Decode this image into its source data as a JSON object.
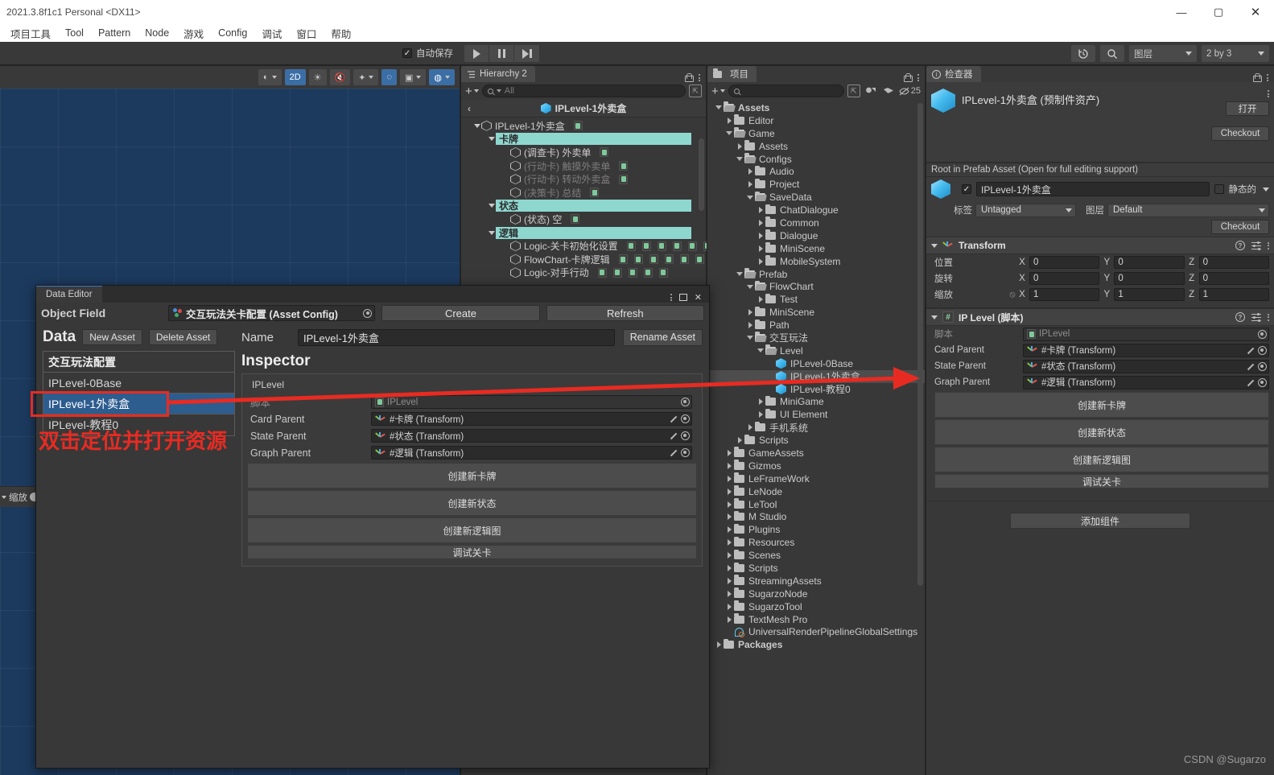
{
  "window": {
    "title": "2021.3.8f1c1 Personal <DX11>",
    "minimize": "—",
    "maximize": "▢",
    "close": "✕"
  },
  "menu": {
    "items": [
      "项目工具",
      "Tool",
      "Pattern",
      "Node",
      "游戏",
      "Config",
      "调试",
      "窗口",
      "帮助"
    ]
  },
  "toolbar": {
    "play": "play-icon",
    "pause": "pause-icon",
    "step": "step-icon",
    "history_icon": "history-icon",
    "search_icon": "search-icon",
    "layers_label": "图层",
    "layout_label": "2 by 3"
  },
  "scene": {
    "autosave_label": "自动保存",
    "autosave_checked": "✓",
    "toolbar_buttons": [
      {
        "name": "shading-mode",
        "label": "◐",
        "active": false,
        "caret": true
      },
      {
        "name": "2d-toggle",
        "label": "2D",
        "active": true,
        "caret": false
      },
      {
        "name": "lighting-toggle",
        "label": "☀",
        "active": false,
        "caret": false
      },
      {
        "name": "audio-toggle",
        "label": "🔇",
        "active": false,
        "caret": false
      },
      {
        "name": "effects-toggle",
        "label": "✦",
        "active": false,
        "caret": true
      },
      {
        "name": "hidden-objects-toggle",
        "label": "◌",
        "active": true,
        "caret": false
      },
      {
        "name": "camera-settings",
        "label": "▣",
        "active": false,
        "caret": true
      },
      {
        "name": "gizmos-toggle",
        "label": "◍",
        "active": true,
        "caret": true
      }
    ],
    "bottom_label": "缩放"
  },
  "hierarchy": {
    "tab_label": "Hierarchy 2",
    "search_placeholder": "All",
    "breadcrumb": "IPLevel-1外卖盒",
    "tree": [
      {
        "indent": 0,
        "guide": "",
        "fold": "down",
        "label": "IPLevel-1外卖盒",
        "style": "normal",
        "badges": 1
      },
      {
        "indent": 1,
        "guide": "├",
        "fold": "down",
        "label": "卡牌",
        "style": "highlight",
        "badges": 0
      },
      {
        "indent": 2,
        "guide": "│ ├",
        "fold": "none",
        "label": "(调查卡) 外卖单",
        "style": "normal",
        "badges": 1
      },
      {
        "indent": 2,
        "guide": "│ ├",
        "fold": "none",
        "label": "(行动卡) 触摸外卖单",
        "style": "dim",
        "badges": 1
      },
      {
        "indent": 2,
        "guide": "│ ├",
        "fold": "none",
        "label": "(行动卡) 转动外卖盒",
        "style": "dim",
        "badges": 1
      },
      {
        "indent": 2,
        "guide": "│ └",
        "fold": "none",
        "label": "(决策卡) 总结",
        "style": "dim",
        "badges": 1
      },
      {
        "indent": 1,
        "guide": "├",
        "fold": "down",
        "label": "状态",
        "style": "highlight",
        "badges": 0
      },
      {
        "indent": 2,
        "guide": "│ └",
        "fold": "none",
        "label": "(状态) 空",
        "style": "normal",
        "badges": 1
      },
      {
        "indent": 1,
        "guide": "└",
        "fold": "down",
        "label": "逻辑",
        "style": "highlight",
        "badges": 0
      },
      {
        "indent": 2,
        "guide": "  ├",
        "fold": "none",
        "label": "Logic-关卡初始化设置",
        "style": "normal",
        "badges": 6
      },
      {
        "indent": 2,
        "guide": "  ├",
        "fold": "none",
        "label": "FlowChart-卡牌逻辑",
        "style": "normal",
        "badges": 7
      },
      {
        "indent": 2,
        "guide": "  └",
        "fold": "none",
        "label": "Logic-对手行动",
        "style": "normal",
        "badges": 5
      }
    ]
  },
  "project": {
    "tab_label": "项目",
    "search_placeholder": "",
    "hidden_count": "25",
    "tree": [
      {
        "indent": 0,
        "arrow": "down",
        "icon": "folder-open",
        "label": "Assets",
        "bold": true,
        "selected": false
      },
      {
        "indent": 1,
        "arrow": "right",
        "icon": "folder",
        "label": "Editor",
        "bold": false,
        "selected": false
      },
      {
        "indent": 1,
        "arrow": "down",
        "icon": "folder-open",
        "label": "Game",
        "bold": false,
        "selected": false
      },
      {
        "indent": 2,
        "arrow": "right",
        "icon": "folder",
        "label": "Assets",
        "bold": false,
        "selected": false
      },
      {
        "indent": 2,
        "arrow": "down",
        "icon": "folder-open",
        "label": "Configs",
        "bold": false,
        "selected": false
      },
      {
        "indent": 3,
        "arrow": "right",
        "icon": "folder",
        "label": "Audio",
        "bold": false,
        "selected": false
      },
      {
        "indent": 3,
        "arrow": "right",
        "icon": "folder",
        "label": "Project",
        "bold": false,
        "selected": false
      },
      {
        "indent": 3,
        "arrow": "down",
        "icon": "folder-open",
        "label": "SaveData",
        "bold": false,
        "selected": false
      },
      {
        "indent": 4,
        "arrow": "right",
        "icon": "folder",
        "label": "ChatDialogue",
        "bold": false,
        "selected": false
      },
      {
        "indent": 4,
        "arrow": "right",
        "icon": "folder",
        "label": "Common",
        "bold": false,
        "selected": false
      },
      {
        "indent": 4,
        "arrow": "right",
        "icon": "folder",
        "label": "Dialogue",
        "bold": false,
        "selected": false
      },
      {
        "indent": 4,
        "arrow": "right",
        "icon": "folder",
        "label": "MiniScene",
        "bold": false,
        "selected": false
      },
      {
        "indent": 4,
        "arrow": "right",
        "icon": "folder",
        "label": "MobileSystem",
        "bold": false,
        "selected": false
      },
      {
        "indent": 2,
        "arrow": "down",
        "icon": "folder-open",
        "label": "Prefab",
        "bold": false,
        "selected": false
      },
      {
        "indent": 3,
        "arrow": "down",
        "icon": "folder-open",
        "label": "FlowChart",
        "bold": false,
        "selected": false
      },
      {
        "indent": 4,
        "arrow": "right",
        "icon": "folder",
        "label": "Test",
        "bold": false,
        "selected": false
      },
      {
        "indent": 3,
        "arrow": "right",
        "icon": "folder",
        "label": "MiniScene",
        "bold": false,
        "selected": false
      },
      {
        "indent": 3,
        "arrow": "right",
        "icon": "folder",
        "label": "Path",
        "bold": false,
        "selected": false
      },
      {
        "indent": 3,
        "arrow": "down",
        "icon": "folder-open",
        "label": "交互玩法",
        "bold": false,
        "selected": false
      },
      {
        "indent": 4,
        "arrow": "down",
        "icon": "folder-open",
        "label": "Level",
        "bold": false,
        "selected": false
      },
      {
        "indent": 5,
        "arrow": "none",
        "icon": "prefab",
        "label": "IPLevel-0Base",
        "bold": false,
        "selected": false
      },
      {
        "indent": 5,
        "arrow": "none",
        "icon": "prefab",
        "label": "IPLevel-1外卖盒",
        "bold": false,
        "selected": true
      },
      {
        "indent": 5,
        "arrow": "none",
        "icon": "prefab",
        "label": "IPLevel-教程0",
        "bold": false,
        "selected": false
      },
      {
        "indent": 4,
        "arrow": "right",
        "icon": "folder",
        "label": "MiniGame",
        "bold": false,
        "selected": false
      },
      {
        "indent": 4,
        "arrow": "right",
        "icon": "folder",
        "label": "UI Element",
        "bold": false,
        "selected": false
      },
      {
        "indent": 3,
        "arrow": "right",
        "icon": "folder",
        "label": "手机系统",
        "bold": false,
        "selected": false
      },
      {
        "indent": 2,
        "arrow": "right",
        "icon": "folder",
        "label": "Scripts",
        "bold": false,
        "selected": false
      },
      {
        "indent": 1,
        "arrow": "right",
        "icon": "folder",
        "label": "GameAssets",
        "bold": false,
        "selected": false
      },
      {
        "indent": 1,
        "arrow": "right",
        "icon": "folder",
        "label": "Gizmos",
        "bold": false,
        "selected": false
      },
      {
        "indent": 1,
        "arrow": "right",
        "icon": "folder",
        "label": "LeFrameWork",
        "bold": false,
        "selected": false
      },
      {
        "indent": 1,
        "arrow": "right",
        "icon": "folder",
        "label": "LeNode",
        "bold": false,
        "selected": false
      },
      {
        "indent": 1,
        "arrow": "right",
        "icon": "folder",
        "label": "LeTool",
        "bold": false,
        "selected": false
      },
      {
        "indent": 1,
        "arrow": "right",
        "icon": "folder",
        "label": "M Studio",
        "bold": false,
        "selected": false
      },
      {
        "indent": 1,
        "arrow": "right",
        "icon": "folder",
        "label": "Plugins",
        "bold": false,
        "selected": false
      },
      {
        "indent": 1,
        "arrow": "right",
        "icon": "folder",
        "label": "Resources",
        "bold": false,
        "selected": false
      },
      {
        "indent": 1,
        "arrow": "right",
        "icon": "folder",
        "label": "Scenes",
        "bold": false,
        "selected": false
      },
      {
        "indent": 1,
        "arrow": "right",
        "icon": "folder",
        "label": "Scripts",
        "bold": false,
        "selected": false
      },
      {
        "indent": 1,
        "arrow": "right",
        "icon": "folder",
        "label": "StreamingAssets",
        "bold": false,
        "selected": false
      },
      {
        "indent": 1,
        "arrow": "right",
        "icon": "folder",
        "label": "SugarzoNode",
        "bold": false,
        "selected": false
      },
      {
        "indent": 1,
        "arrow": "right",
        "icon": "folder",
        "label": "SugarzoTool",
        "bold": false,
        "selected": false
      },
      {
        "indent": 1,
        "arrow": "right",
        "icon": "folder",
        "label": "TextMesh Pro",
        "bold": false,
        "selected": false
      },
      {
        "indent": 1,
        "arrow": "none",
        "icon": "urp",
        "label": "UniversalRenderPipelineGlobalSettings",
        "bold": false,
        "selected": false
      },
      {
        "indent": 0,
        "arrow": "right",
        "icon": "folder",
        "label": "Packages",
        "bold": true,
        "selected": false
      }
    ]
  },
  "inspector": {
    "tab_label": "检查器",
    "asset_title": "IPLevel-1外卖盒 (预制件资产)",
    "open_button": "打开",
    "checkout_button_1": "Checkout",
    "prefab_note": "Root in Prefab Asset (Open for full editing support)",
    "object_name": "IPLevel-1外卖盒",
    "enabled_check": "✓",
    "static_label": "静态的",
    "tag_label": "标签",
    "tag_value": "Untagged",
    "layer_label": "图层",
    "layer_value": "Default",
    "checkout_button_2": "Checkout",
    "transform": {
      "title": "Transform",
      "rows": [
        {
          "label": "位置",
          "x": "0",
          "y": "0",
          "z": "0",
          "link": false
        },
        {
          "label": "旋转",
          "x": "0",
          "y": "0",
          "z": "0",
          "link": false
        },
        {
          "label": "缩放",
          "x": "1",
          "y": "1",
          "z": "1",
          "link": true
        }
      ],
      "axes": [
        "X",
        "Y",
        "Z"
      ]
    },
    "iplevel": {
      "title": "IP Level  (脚本)",
      "fields": [
        {
          "label": "脚本",
          "value": "IPLevel",
          "type": "script",
          "disabled": true
        },
        {
          "label": "Card Parent",
          "value": "#卡牌 (Transform)",
          "type": "transform",
          "disabled": false
        },
        {
          "label": "State Parent",
          "value": "#状态 (Transform)",
          "type": "transform",
          "disabled": false
        },
        {
          "label": "Graph Parent",
          "value": "#逻辑 (Transform)",
          "type": "transform",
          "disabled": false
        }
      ],
      "buttons": [
        "创建新卡牌",
        "创建新状态",
        "创建新逻辑图"
      ],
      "thin_button": "调试关卡"
    },
    "add_component": "添加组件"
  },
  "data_editor": {
    "tab_label": "Data Editor",
    "object_field_label": "Object Field",
    "object_field_value": "交互玩法关卡配置 (Asset Config)",
    "create_button": "Create",
    "refresh_button": "Refresh",
    "data_label": "Data",
    "new_asset_button": "New Asset",
    "delete_asset_button": "Delete Asset",
    "list": [
      {
        "label": "交互玩法配置",
        "header": true,
        "selected": false
      },
      {
        "label": "IPLevel-0Base",
        "header": false,
        "selected": false
      },
      {
        "label": "IPLevel-1外卖盒",
        "header": false,
        "selected": true
      },
      {
        "label": "IPLevel-教程0",
        "header": false,
        "selected": false
      }
    ],
    "name_label": "Name",
    "name_value": "IPLevel-1外卖盒",
    "rename_button": "Rename Asset",
    "inspector_title": "Inspector",
    "iplevel_label": "IPLevel",
    "fields": [
      {
        "label": "脚本",
        "value": "IPLevel",
        "type": "script",
        "disabled": true
      },
      {
        "label": "Card Parent",
        "value": "#卡牌 (Transform)",
        "type": "transform",
        "disabled": false
      },
      {
        "label": "State Parent",
        "value": "#状态 (Transform)",
        "type": "transform",
        "disabled": false
      },
      {
        "label": "Graph Parent",
        "value": "#逻辑 (Transform)",
        "type": "transform",
        "disabled": false
      }
    ],
    "buttons": [
      "创建新卡牌",
      "创建新状态",
      "创建新逻辑图"
    ],
    "thin_button": "调试关卡"
  },
  "annotation": {
    "text": "双击定位并打开资源",
    "color": "#e82b22"
  },
  "watermark": "CSDN @Sugarzo"
}
